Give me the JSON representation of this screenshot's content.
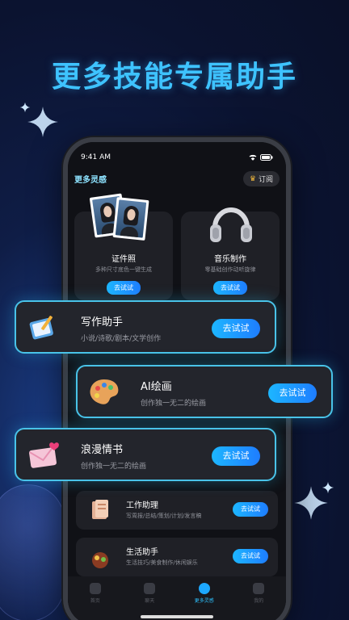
{
  "headline": "更多技能专属助手",
  "status": {
    "time": "9:41 AM"
  },
  "header": {
    "brand": "更多灵感",
    "subscribe": "订阅"
  },
  "grid": [
    {
      "title": "证件照",
      "desc": "多种尺寸底色一键生成",
      "btn": "去试试"
    },
    {
      "title": "音乐制作",
      "desc": "零基础创作动听旋律",
      "btn": "去试试"
    }
  ],
  "featured": [
    {
      "title": "写作助手",
      "desc": "小说/诗歌/剧本/文学创作",
      "btn": "去试试"
    },
    {
      "title": "AI绘画",
      "desc": "创作独一无二的绘画",
      "btn": "去试试"
    },
    {
      "title": "浪漫情书",
      "desc": "创作独一无二的绘画",
      "btn": "去试试"
    }
  ],
  "list": [
    {
      "title": "工作助理",
      "desc": "写周报/总结/策划/计划/发言稿",
      "btn": "去试试"
    },
    {
      "title": "生活助手",
      "desc": "生活技巧/美食制作/休闲娱乐",
      "btn": "去试试"
    }
  ],
  "tabs": [
    {
      "label": "首页",
      "active": false
    },
    {
      "label": "聊天",
      "active": false
    },
    {
      "label": "更多灵感",
      "active": true
    },
    {
      "label": "我的",
      "active": false
    }
  ],
  "colors": {
    "accent": "#1db6ff",
    "cardBorder": "#49c3e8",
    "headline": "#3ec3ff"
  }
}
